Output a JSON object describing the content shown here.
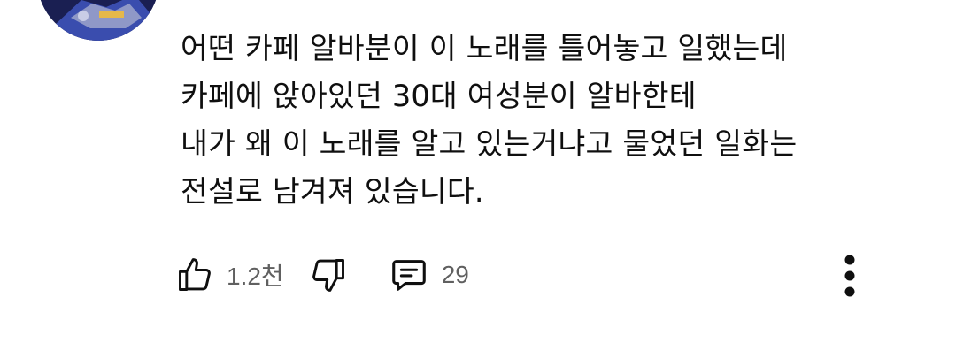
{
  "comment": {
    "lines": [
      "어떤 카페 알바분이 이 노래를 틀어놓고 일했는데",
      "카페에 앉아있던 30대 여성분이 알바한테",
      "내가 왜 이 노래를 알고 있는거냐고 물었던 일화는",
      "전설로 남겨져 있습니다."
    ]
  },
  "actions": {
    "like_count": "1.2천",
    "reply_count": "29"
  },
  "icons": {
    "like": "thumbs-up-icon",
    "dislike": "thumbs-down-icon",
    "replies": "comment-icon",
    "more": "more-vert-icon"
  },
  "colors": {
    "text": "#0f0f0f",
    "secondary": "#606060"
  }
}
